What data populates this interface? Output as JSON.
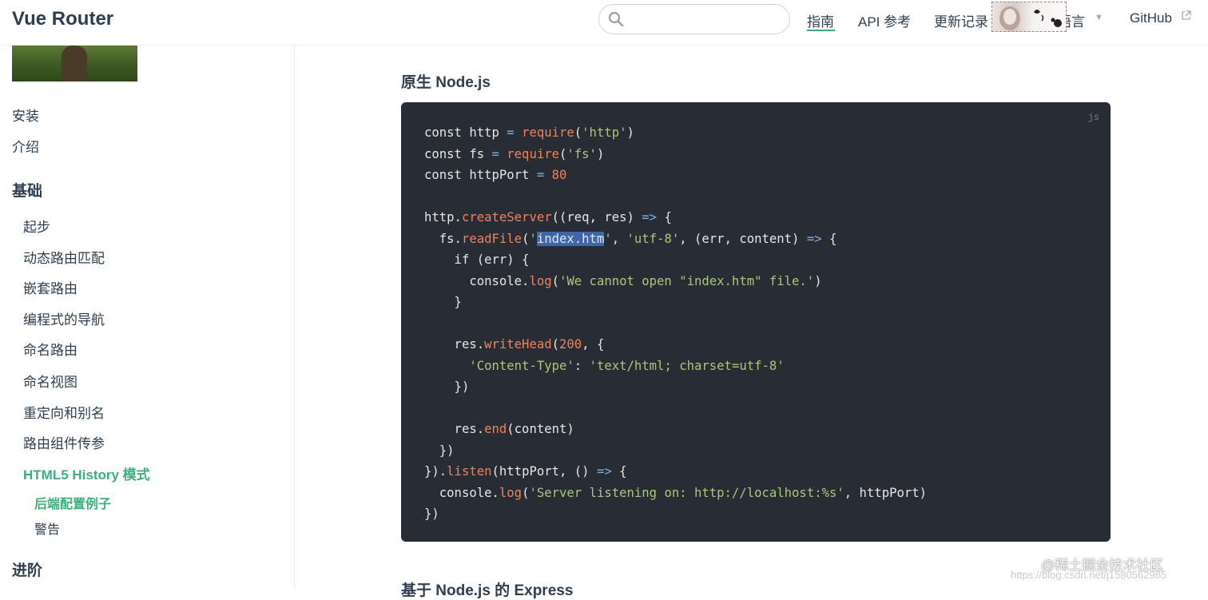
{
  "header": {
    "brand": "Vue Router",
    "search_placeholder": "",
    "nav": [
      "指南",
      "API 参考",
      "更新记录",
      "语言",
      "GitHub"
    ]
  },
  "sidebar": {
    "items_top": [
      "安装",
      "介绍"
    ],
    "section_basics": "基础",
    "basics_items": [
      "起步",
      "动态路由匹配",
      "嵌套路由",
      "编程式的导航",
      "命名路由",
      "命名视图",
      "重定向和别名",
      "路由组件传参"
    ],
    "active_item": "HTML5 History 模式",
    "sub_items": [
      "后端配置例子",
      "警告"
    ],
    "section_advanced": "进阶"
  },
  "content": {
    "heading": "原生 Node.js",
    "next_heading": "基于 Node.js 的 Express",
    "code_lang": "js",
    "code_lines": [
      "const http = require('http')",
      "const fs = require('fs')",
      "const httpPort = 80",
      "",
      "http.createServer((req, res) => {",
      "  fs.readFile('index.htm', 'utf-8', (err, content) => {",
      "    if (err) {",
      "      console.log('We cannot open \"index.htm\" file.')",
      "    }",
      "",
      "    res.writeHead(200, {",
      "      'Content-Type': 'text/html; charset=utf-8'",
      "    })",
      "",
      "    res.end(content)",
      "  })",
      "}).listen(httpPort, () => {",
      "  console.log('Server listening on: http://localhost:%s', httpPort)",
      "})"
    ],
    "selected_text": "index.htm"
  },
  "watermark": {
    "brand": "@稀土掘金技术社区",
    "url": "https://blog.csdn.net/j1580562985"
  },
  "colors": {
    "accent": "#3eaf7c",
    "code_bg": "#282c34"
  }
}
